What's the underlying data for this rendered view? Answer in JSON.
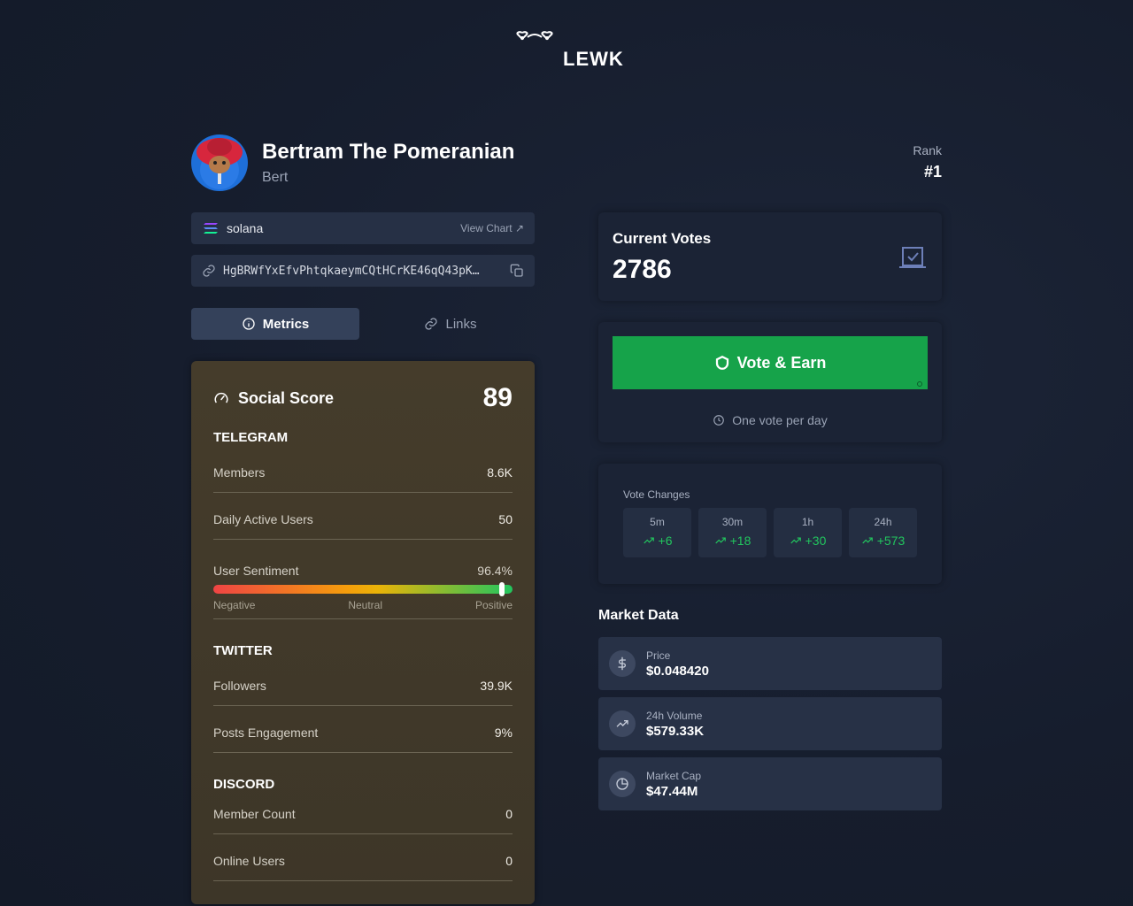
{
  "brand": {
    "name": "LEWK"
  },
  "token": {
    "name": "Bertram The Pomeranian",
    "ticker": "Bert",
    "chain": "solana",
    "view_chart": "View Chart ↗",
    "address": "HgBRWfYxEfvPhtqkaeymCQtHCrKE46qQ43pK…"
  },
  "rank": {
    "label": "Rank",
    "value": "#1"
  },
  "tabs": [
    {
      "label": "Metrics",
      "active": true
    },
    {
      "label": "Links",
      "active": false
    }
  ],
  "social": {
    "title": "Social Score",
    "score": "89",
    "telegram": {
      "title": "TELEGRAM",
      "members_label": "Members",
      "members_value": "8.6K",
      "dau_label": "Daily Active Users",
      "dau_value": "50",
      "sentiment_label": "User Sentiment",
      "sentiment_value": "96.4%",
      "sentiment_fraction": 0.964,
      "scale": [
        "Negative",
        "Neutral",
        "Positive"
      ]
    },
    "twitter": {
      "title": "TWITTER",
      "followers_label": "Followers",
      "followers_value": "39.9K",
      "engagement_label": "Posts Engagement",
      "engagement_value": "9%"
    },
    "discord": {
      "title": "DISCORD",
      "members_label": "Member Count",
      "members_value": "0",
      "online_label": "Online Users",
      "online_value": "0"
    }
  },
  "votes": {
    "label": "Current Votes",
    "value": "2786",
    "button": "Vote & Earn",
    "note": "One vote per day",
    "changes_label": "Vote Changes",
    "changes": [
      {
        "period": "5m",
        "value": "+6"
      },
      {
        "period": "30m",
        "value": "+18"
      },
      {
        "period": "1h",
        "value": "+30"
      },
      {
        "period": "24h",
        "value": "+573"
      }
    ]
  },
  "market": {
    "title": "Market Data",
    "items": [
      {
        "label": "Price",
        "value": "$0.048420",
        "icon": "dollar-icon"
      },
      {
        "label": "24h Volume",
        "value": "$579.33K",
        "icon": "trending-up-icon"
      },
      {
        "label": "Market Cap",
        "value": "$47.44M",
        "icon": "pie-chart-icon"
      }
    ]
  },
  "colors": {
    "accent_green": "#16a34a",
    "positive": "#22c55e",
    "panel": "#1b2335"
  }
}
